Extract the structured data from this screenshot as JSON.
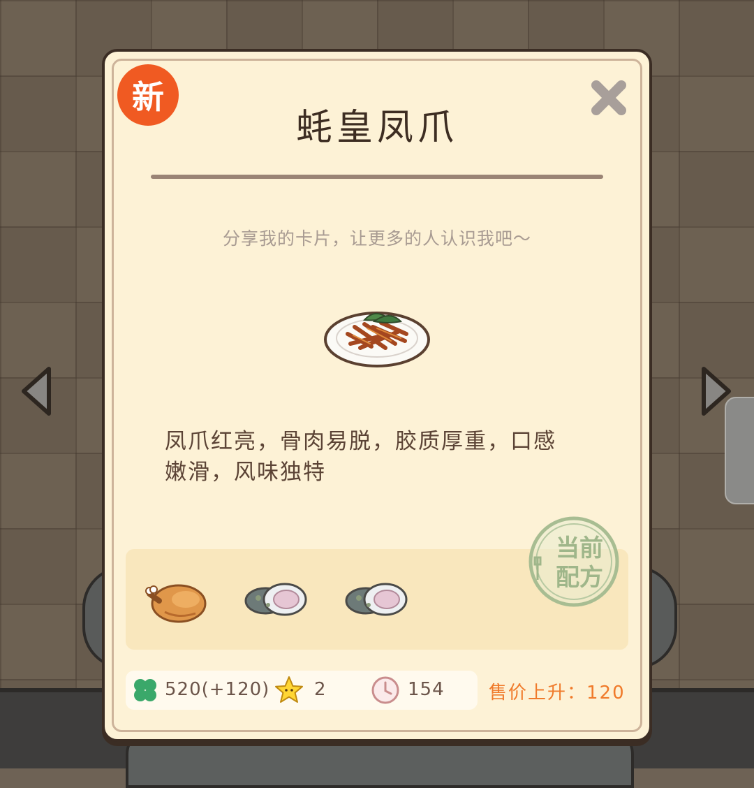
{
  "badge": {
    "label": "新"
  },
  "recipe": {
    "title": "蚝皇凤爪",
    "share_hint": "分享我的卡片，让更多的人认识我吧～",
    "description_line1": "凤爪红亮，骨肉易脱，胶质厚重，口感",
    "description_line2": "嫩滑，风味独特"
  },
  "ingredients": [
    {
      "name": "roast-chicken-icon"
    },
    {
      "name": "oyster-icon"
    },
    {
      "name": "oyster-icon"
    }
  ],
  "stamp": {
    "line1": "当前",
    "line2": "配方"
  },
  "stats": {
    "clover_value": "520(+120)",
    "star_value": "2",
    "time_value": "154"
  },
  "price": {
    "label": "售价上升：120"
  },
  "colors": {
    "card_bg": "#fdf2d6",
    "badge": "#f05a22",
    "price": "#f07a2a",
    "stamp": "#9fb68a"
  }
}
